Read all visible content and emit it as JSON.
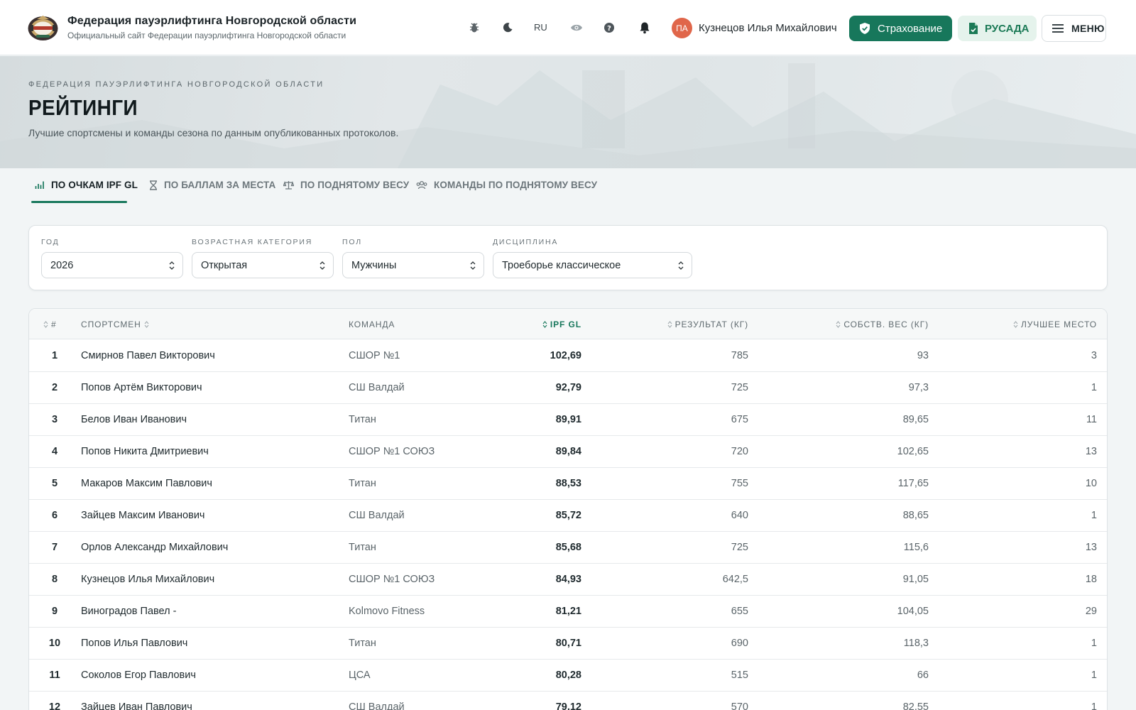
{
  "header": {
    "site_title": "Федерация пауэрлифтинга Новгородской области",
    "site_subtitle": "Официальный сайт Федерации пауэрлифтинга Новгородской области",
    "lang": "RU",
    "user": {
      "initials": "ПА",
      "name": "Кузнецов Илья Михайлович"
    },
    "insurance_label": "Страхование",
    "rusada_label": "РУСАДА",
    "menu_label": "МЕНЮ"
  },
  "hero": {
    "eyebrow": "ФЕДЕРАЦИЯ ПАУЭРЛИФТИНГА НОВГОРОДСКОЙ ОБЛАСТИ",
    "title": "РЕЙТИНГИ",
    "subtitle": "Лучшие спортсмены и команды сезона по данным опубликованных протоколов."
  },
  "tabs": [
    {
      "label": "ПО ОЧКАМ IPF GL",
      "active": true
    },
    {
      "label": "ПО БАЛЛАМ ЗА МЕСТА",
      "active": false
    },
    {
      "label": "ПО ПОДНЯТОМУ ВЕСУ",
      "active": false
    },
    {
      "label": "КОМАНДЫ ПО ПОДНЯТОМУ ВЕСУ",
      "active": false
    }
  ],
  "filters": {
    "year": {
      "label": "ГОД",
      "value": "2026"
    },
    "age": {
      "label": "ВОЗРАСТНАЯ КАТЕГОРИЯ",
      "value": "Открытая"
    },
    "sex": {
      "label": "ПОЛ",
      "value": "Мужчины"
    },
    "discipline": {
      "label": "ДИСЦИПЛИНА",
      "value": "Троеборье классическое"
    }
  },
  "table": {
    "columns": {
      "rank": "#",
      "athlete": "СПОРТСМЕН",
      "team": "КОМАНДА",
      "ipf_gl": "IPF GL",
      "result": "РЕЗУЛЬТАТ (КГ)",
      "bodyweight": "СОБСТВ. ВЕС (КГ)",
      "best_place": "ЛУЧШЕЕ МЕСТО"
    },
    "rows": [
      {
        "rank": "1",
        "athlete": "Смирнов Павел Викторович",
        "team": "СШОР №1",
        "ipf_gl": "102,69",
        "result": "785",
        "bodyweight": "93",
        "best_place": "3"
      },
      {
        "rank": "2",
        "athlete": "Попов Артём Викторович",
        "team": "СШ Валдай",
        "ipf_gl": "92,79",
        "result": "725",
        "bodyweight": "97,3",
        "best_place": "1"
      },
      {
        "rank": "3",
        "athlete": "Белов Иван Иванович",
        "team": "Титан",
        "ipf_gl": "89,91",
        "result": "675",
        "bodyweight": "89,65",
        "best_place": "11"
      },
      {
        "rank": "4",
        "athlete": "Попов Никита Дмитриевич",
        "team": "СШОР №1 СОЮЗ",
        "ipf_gl": "89,84",
        "result": "720",
        "bodyweight": "102,65",
        "best_place": "13"
      },
      {
        "rank": "5",
        "athlete": "Макаров Максим Павлович",
        "team": "Титан",
        "ipf_gl": "88,53",
        "result": "755",
        "bodyweight": "117,65",
        "best_place": "10"
      },
      {
        "rank": "6",
        "athlete": "Зайцев Максим Иванович",
        "team": "СШ Валдай",
        "ipf_gl": "85,72",
        "result": "640",
        "bodyweight": "88,65",
        "best_place": "1"
      },
      {
        "rank": "7",
        "athlete": "Орлов Александр Михайлович",
        "team": "Титан",
        "ipf_gl": "85,68",
        "result": "725",
        "bodyweight": "115,6",
        "best_place": "13"
      },
      {
        "rank": "8",
        "athlete": "Кузнецов Илья Михайлович",
        "team": "СШОР №1 СОЮЗ",
        "ipf_gl": "84,93",
        "result": "642,5",
        "bodyweight": "91,05",
        "best_place": "18"
      },
      {
        "rank": "9",
        "athlete": "Виноградов Павел -",
        "team": "Kolmovo Fitness",
        "ipf_gl": "81,21",
        "result": "655",
        "bodyweight": "104,05",
        "best_place": "29"
      },
      {
        "rank": "10",
        "athlete": "Попов Илья Павлович",
        "team": "Титан",
        "ipf_gl": "80,71",
        "result": "690",
        "bodyweight": "118,3",
        "best_place": "1"
      },
      {
        "rank": "11",
        "athlete": "Соколов Егор Павлович",
        "team": "ЦСА",
        "ipf_gl": "80,28",
        "result": "515",
        "bodyweight": "66",
        "best_place": "1"
      },
      {
        "rank": "12",
        "athlete": "Зайцев Иван Павлович",
        "team": "СШ Валдай",
        "ipf_gl": "79,12",
        "result": "570",
        "bodyweight": "82,55",
        "best_place": "1"
      }
    ]
  },
  "colors": {
    "accent": "#17775b",
    "accent_light": "#e5f3ec",
    "avatar": "#e0664a"
  }
}
